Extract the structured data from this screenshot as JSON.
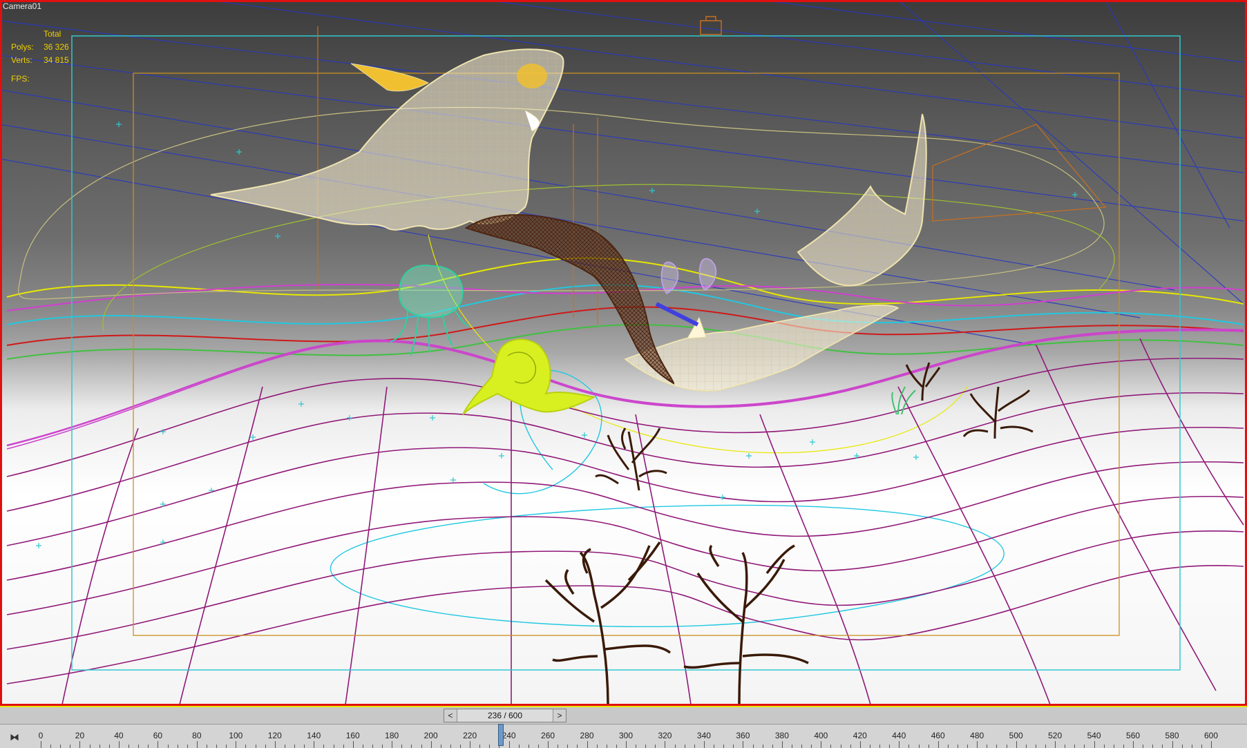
{
  "viewport": {
    "label": "Camera01",
    "stats": {
      "header": "Total",
      "polys_label": "Polys:",
      "polys_value": "36 326",
      "verts_label": "Verts:",
      "verts_value": "34 815",
      "fps_label": "FPS:"
    },
    "objects": [
      "shark-large",
      "shark-right",
      "shark-small",
      "eel",
      "jellyfish",
      "snail",
      "seahorses",
      "coral-center",
      "coral-right",
      "coral-bottom-left",
      "coral-bottom-right",
      "seaweed"
    ]
  },
  "timeline": {
    "frame_display": "236 / 600",
    "prev_arrow": "<",
    "next_arrow": ">",
    "current_frame": 236,
    "total_frames": 600,
    "tick_labels": [
      "0",
      "20",
      "40",
      "60",
      "80",
      "100",
      "120",
      "140",
      "160",
      "180",
      "200",
      "220",
      "240",
      "260",
      "280",
      "300",
      "320",
      "340",
      "360",
      "380",
      "400",
      "420",
      "440",
      "460",
      "480",
      "500",
      "520",
      "540",
      "560",
      "580",
      "600"
    ]
  },
  "colors": {
    "viewport_border": "#e01010",
    "stats_text": "#f0d000",
    "safe_frame_outer": "#30c8d0",
    "safe_frame_inner": "#c89020",
    "terrain_wire": "#901878",
    "timebar_accent": "#e8e800"
  }
}
